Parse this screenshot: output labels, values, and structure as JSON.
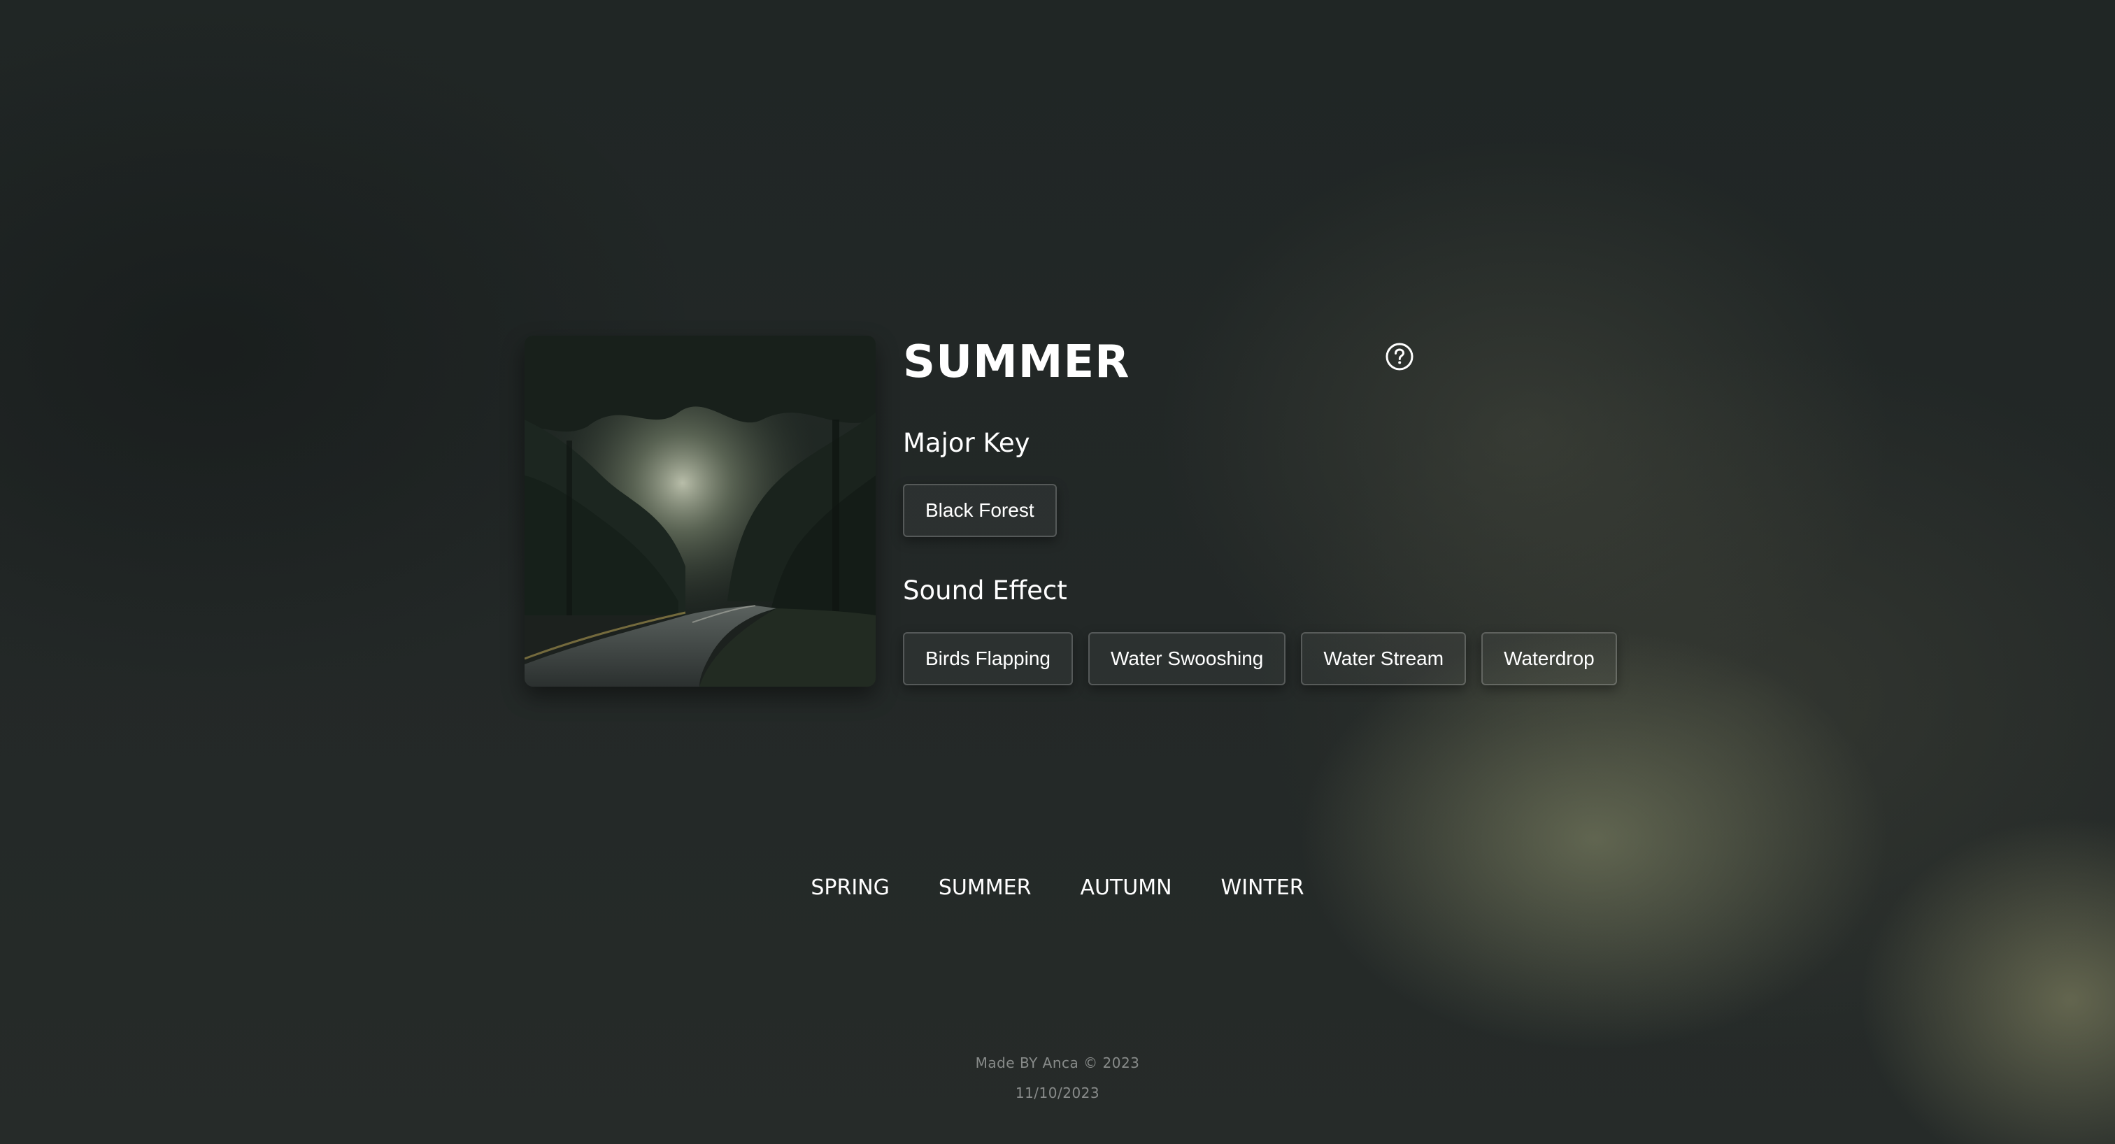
{
  "colors": {
    "background": "#212626",
    "text": "#ffffff",
    "muted_text": "#8a8d8b",
    "chip_border": "#5a5f5d"
  },
  "album": {
    "image_description": "forest-road-artwork"
  },
  "header": {
    "title": "SUMMER",
    "help_icon": "question-circle-icon"
  },
  "major_key": {
    "heading": "Major Key",
    "options": [
      "Black Forest"
    ]
  },
  "sound_effect": {
    "heading": "Sound Effect",
    "options": [
      "Birds Flapping",
      "Water Swooshing",
      "Water Stream",
      "Waterdrop"
    ]
  },
  "season_nav": {
    "items": [
      "SPRING",
      "SUMMER",
      "AUTUMN",
      "WINTER"
    ]
  },
  "footer": {
    "credit": "Made BY Anca © 2023",
    "date": "11/10/2023"
  }
}
